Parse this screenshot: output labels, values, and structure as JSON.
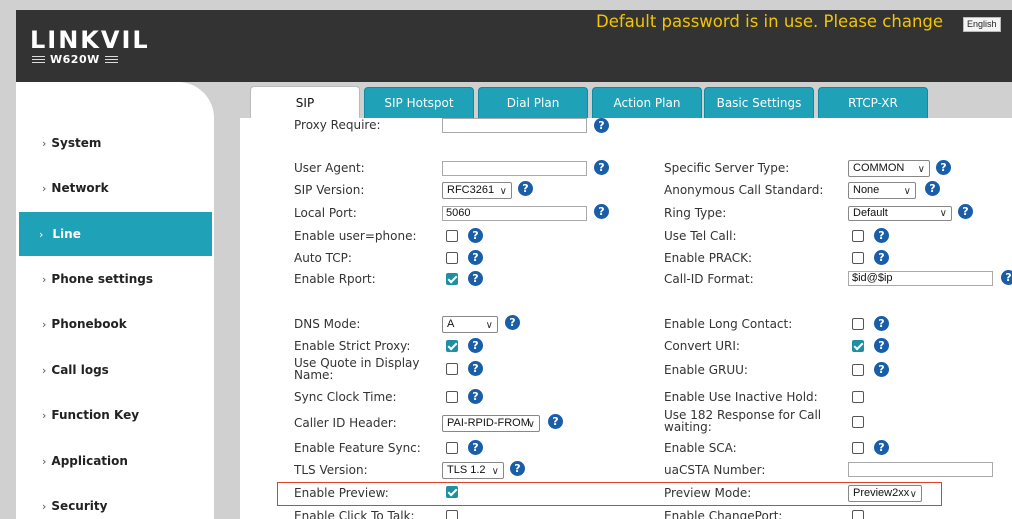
{
  "header": {
    "logo": "LINKVIL",
    "model": "W620W",
    "warning": "Default password is in use. Please change",
    "language": "English"
  },
  "sidebar": {
    "items": [
      {
        "label": "System"
      },
      {
        "label": "Network"
      },
      {
        "label": "Line",
        "active": true
      },
      {
        "label": "Phone settings"
      },
      {
        "label": "Phonebook"
      },
      {
        "label": "Call logs"
      },
      {
        "label": "Function Key"
      },
      {
        "label": "Application"
      },
      {
        "label": "Security"
      }
    ]
  },
  "tabs": [
    {
      "label": "SIP",
      "active": true
    },
    {
      "label": "SIP Hotspot"
    },
    {
      "label": "Dial Plan"
    },
    {
      "label": "Action Plan"
    },
    {
      "label": "Basic Settings"
    },
    {
      "label": "RTCP-XR"
    }
  ],
  "colors": {
    "accent": "#1fa2b8",
    "header_bg": "#333333",
    "warning": "#f2c500",
    "highlight_border": "#e0412a",
    "help_icon": "#1a5ea8"
  },
  "left_fields": {
    "proxy_require": {
      "label": "Proxy Require:",
      "value": ""
    },
    "user_agent": {
      "label": "User Agent:",
      "value": ""
    },
    "sip_version": {
      "label": "SIP Version:",
      "value": "RFC3261"
    },
    "local_port": {
      "label": "Local Port:",
      "value": "5060"
    },
    "enable_user_phone": {
      "label": "Enable user=phone:",
      "checked": false
    },
    "auto_tcp": {
      "label": "Auto TCP:",
      "checked": false
    },
    "enable_rport": {
      "label": "Enable Rport:",
      "checked": true
    },
    "dns_mode": {
      "label": "DNS Mode:",
      "value": "A"
    },
    "enable_strict_proxy": {
      "label": "Enable Strict Proxy:",
      "checked": true
    },
    "use_quote": {
      "label": "Use Quote in Display Name:",
      "checked": false
    },
    "sync_clock_time": {
      "label": "Sync Clock Time:",
      "checked": false
    },
    "caller_id_header": {
      "label": "Caller ID Header:",
      "value": "PAI-RPID-FROM"
    },
    "enable_feature_sync": {
      "label": "Enable Feature Sync:",
      "checked": false
    },
    "tls_version": {
      "label": "TLS Version:",
      "value": "TLS 1.2"
    },
    "enable_preview": {
      "label": "Enable Preview:",
      "checked": true
    },
    "enable_click_to_talk": {
      "label": "Enable Click To Talk:",
      "checked": false
    }
  },
  "right_fields": {
    "specific_server_type": {
      "label": "Specific Server Type:",
      "value": "COMMON"
    },
    "anonymous_call_standard": {
      "label": "Anonymous Call Standard:",
      "value": "None"
    },
    "ring_type": {
      "label": "Ring Type:",
      "value": "Default"
    },
    "use_tel_call": {
      "label": "Use Tel Call:",
      "checked": false
    },
    "enable_prack": {
      "label": "Enable PRACK:",
      "checked": false
    },
    "call_id_format": {
      "label": "Call-ID Format:",
      "value": "$id@$ip"
    },
    "enable_long_contact": {
      "label": "Enable Long Contact:",
      "checked": false
    },
    "convert_uri": {
      "label": "Convert URI:",
      "checked": true
    },
    "enable_gruu": {
      "label": "Enable GRUU:",
      "checked": false
    },
    "enable_use_inactive_hold": {
      "label": "Enable Use Inactive Hold:",
      "checked": false
    },
    "use_182_response": {
      "label": "Use 182 Response for Call waiting:",
      "checked": false
    },
    "enable_sca": {
      "label": "Enable SCA:",
      "checked": false
    },
    "uacsta_number": {
      "label": "uaCSTA Number:",
      "value": ""
    },
    "preview_mode": {
      "label": "Preview Mode:",
      "value": "Preview2xx"
    },
    "enable_changeport": {
      "label": "Enable ChangePort:",
      "checked": false
    }
  }
}
